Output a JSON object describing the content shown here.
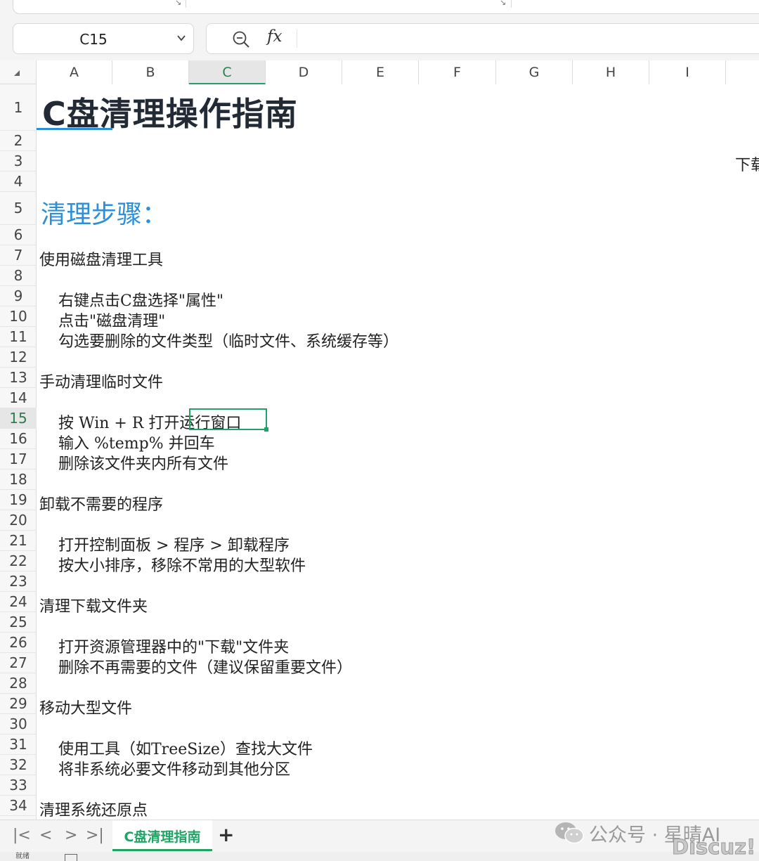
{
  "name_box": {
    "value": "C15"
  },
  "formula_bar": {
    "fx_label": "fx",
    "value": ""
  },
  "columns": [
    "A",
    "B",
    "C",
    "D",
    "E",
    "F",
    "G",
    "H",
    "I"
  ],
  "active_column": "C",
  "active_row": "15",
  "rows": [
    "1",
    "2",
    "3",
    "4",
    "5",
    "6",
    "7",
    "8",
    "9",
    "10",
    "11",
    "12",
    "13",
    "14",
    "15",
    "16",
    "17",
    "18",
    "19",
    "20",
    "21",
    "22",
    "23",
    "24",
    "25",
    "26",
    "27",
    "28",
    "29",
    "30",
    "31",
    "32",
    "33",
    "34"
  ],
  "cells": {
    "title": "C盘清理操作指南",
    "r3_partial": "下载",
    "subtitle": "清理步骤：",
    "r7": "使用磁盘清理工具",
    "r9": "右键点击C盘选择\"属性\"",
    "r10": "点击\"磁盘清理\"",
    "r11": "勾选要删除的文件类型（临时文件、系统缓存等）",
    "r13": "手动清理临时文件",
    "r15": "按 Win + R 打开运行窗口",
    "r16": "输入 %temp% 并回车",
    "r17": "删除该文件夹内所有文件",
    "r19": "卸载不需要的程序",
    "r21": "打开控制面板 > 程序 > 卸载程序",
    "r22": "按大小排序，移除不常用的大型软件",
    "r24": "清理下载文件夹",
    "r26": "打开资源管理器中的\"下载\"文件夹",
    "r27": "删除不再需要的文件（建议保留重要文件）",
    "r29": "移动大型文件",
    "r31": "使用工具（如TreeSize）查找大文件",
    "r32": "将非系统必要文件移动到其他分区",
    "r34": "清理系统还原点"
  },
  "sheet_tabs": [
    {
      "label": "C盘清理指南",
      "active": true
    }
  ],
  "add_sheet_label": "+",
  "nav_buttons": {
    "first": "|<",
    "prev": "<",
    "next": ">",
    "last": ">|"
  },
  "status": {
    "left_text": "就绪"
  },
  "watermark": {
    "text": "公众号 · 星晴AI",
    "logo": "Discuz!"
  },
  "colors": {
    "accent": "#21a366",
    "title_blue": "#2e8fd6",
    "title_dark": "#222a35"
  }
}
